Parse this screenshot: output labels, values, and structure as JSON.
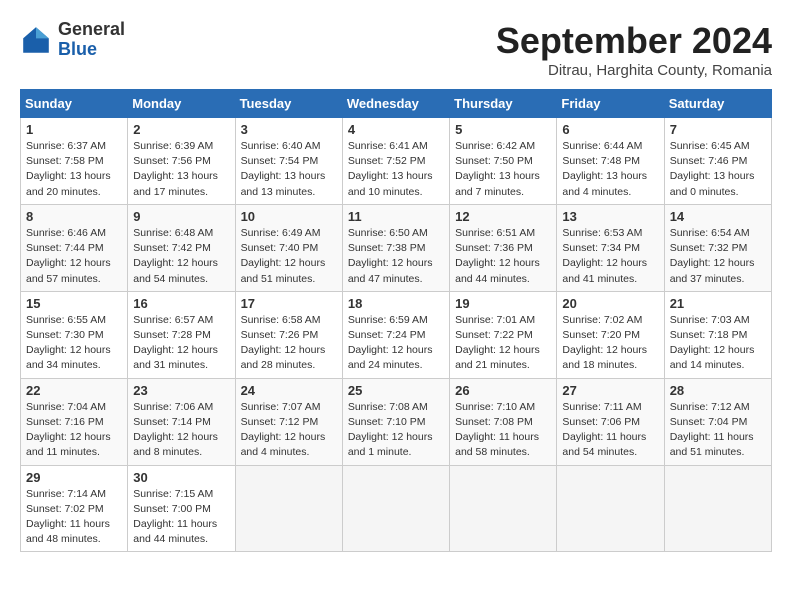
{
  "header": {
    "logo_line1": "General",
    "logo_line2": "Blue",
    "title": "September 2024",
    "location": "Ditrau, Harghita County, Romania"
  },
  "weekdays": [
    "Sunday",
    "Monday",
    "Tuesday",
    "Wednesday",
    "Thursday",
    "Friday",
    "Saturday"
  ],
  "weeks": [
    [
      {
        "day": "1",
        "info": "Sunrise: 6:37 AM\nSunset: 7:58 PM\nDaylight: 13 hours\nand 20 minutes."
      },
      {
        "day": "2",
        "info": "Sunrise: 6:39 AM\nSunset: 7:56 PM\nDaylight: 13 hours\nand 17 minutes."
      },
      {
        "day": "3",
        "info": "Sunrise: 6:40 AM\nSunset: 7:54 PM\nDaylight: 13 hours\nand 13 minutes."
      },
      {
        "day": "4",
        "info": "Sunrise: 6:41 AM\nSunset: 7:52 PM\nDaylight: 13 hours\nand 10 minutes."
      },
      {
        "day": "5",
        "info": "Sunrise: 6:42 AM\nSunset: 7:50 PM\nDaylight: 13 hours\nand 7 minutes."
      },
      {
        "day": "6",
        "info": "Sunrise: 6:44 AM\nSunset: 7:48 PM\nDaylight: 13 hours\nand 4 minutes."
      },
      {
        "day": "7",
        "info": "Sunrise: 6:45 AM\nSunset: 7:46 PM\nDaylight: 13 hours\nand 0 minutes."
      }
    ],
    [
      {
        "day": "8",
        "info": "Sunrise: 6:46 AM\nSunset: 7:44 PM\nDaylight: 12 hours\nand 57 minutes."
      },
      {
        "day": "9",
        "info": "Sunrise: 6:48 AM\nSunset: 7:42 PM\nDaylight: 12 hours\nand 54 minutes."
      },
      {
        "day": "10",
        "info": "Sunrise: 6:49 AM\nSunset: 7:40 PM\nDaylight: 12 hours\nand 51 minutes."
      },
      {
        "day": "11",
        "info": "Sunrise: 6:50 AM\nSunset: 7:38 PM\nDaylight: 12 hours\nand 47 minutes."
      },
      {
        "day": "12",
        "info": "Sunrise: 6:51 AM\nSunset: 7:36 PM\nDaylight: 12 hours\nand 44 minutes."
      },
      {
        "day": "13",
        "info": "Sunrise: 6:53 AM\nSunset: 7:34 PM\nDaylight: 12 hours\nand 41 minutes."
      },
      {
        "day": "14",
        "info": "Sunrise: 6:54 AM\nSunset: 7:32 PM\nDaylight: 12 hours\nand 37 minutes."
      }
    ],
    [
      {
        "day": "15",
        "info": "Sunrise: 6:55 AM\nSunset: 7:30 PM\nDaylight: 12 hours\nand 34 minutes."
      },
      {
        "day": "16",
        "info": "Sunrise: 6:57 AM\nSunset: 7:28 PM\nDaylight: 12 hours\nand 31 minutes."
      },
      {
        "day": "17",
        "info": "Sunrise: 6:58 AM\nSunset: 7:26 PM\nDaylight: 12 hours\nand 28 minutes."
      },
      {
        "day": "18",
        "info": "Sunrise: 6:59 AM\nSunset: 7:24 PM\nDaylight: 12 hours\nand 24 minutes."
      },
      {
        "day": "19",
        "info": "Sunrise: 7:01 AM\nSunset: 7:22 PM\nDaylight: 12 hours\nand 21 minutes."
      },
      {
        "day": "20",
        "info": "Sunrise: 7:02 AM\nSunset: 7:20 PM\nDaylight: 12 hours\nand 18 minutes."
      },
      {
        "day": "21",
        "info": "Sunrise: 7:03 AM\nSunset: 7:18 PM\nDaylight: 12 hours\nand 14 minutes."
      }
    ],
    [
      {
        "day": "22",
        "info": "Sunrise: 7:04 AM\nSunset: 7:16 PM\nDaylight: 12 hours\nand 11 minutes."
      },
      {
        "day": "23",
        "info": "Sunrise: 7:06 AM\nSunset: 7:14 PM\nDaylight: 12 hours\nand 8 minutes."
      },
      {
        "day": "24",
        "info": "Sunrise: 7:07 AM\nSunset: 7:12 PM\nDaylight: 12 hours\nand 4 minutes."
      },
      {
        "day": "25",
        "info": "Sunrise: 7:08 AM\nSunset: 7:10 PM\nDaylight: 12 hours\nand 1 minute."
      },
      {
        "day": "26",
        "info": "Sunrise: 7:10 AM\nSunset: 7:08 PM\nDaylight: 11 hours\nand 58 minutes."
      },
      {
        "day": "27",
        "info": "Sunrise: 7:11 AM\nSunset: 7:06 PM\nDaylight: 11 hours\nand 54 minutes."
      },
      {
        "day": "28",
        "info": "Sunrise: 7:12 AM\nSunset: 7:04 PM\nDaylight: 11 hours\nand 51 minutes."
      }
    ],
    [
      {
        "day": "29",
        "info": "Sunrise: 7:14 AM\nSunset: 7:02 PM\nDaylight: 11 hours\nand 48 minutes."
      },
      {
        "day": "30",
        "info": "Sunrise: 7:15 AM\nSunset: 7:00 PM\nDaylight: 11 hours\nand 44 minutes."
      },
      {
        "day": "",
        "info": ""
      },
      {
        "day": "",
        "info": ""
      },
      {
        "day": "",
        "info": ""
      },
      {
        "day": "",
        "info": ""
      },
      {
        "day": "",
        "info": ""
      }
    ]
  ]
}
